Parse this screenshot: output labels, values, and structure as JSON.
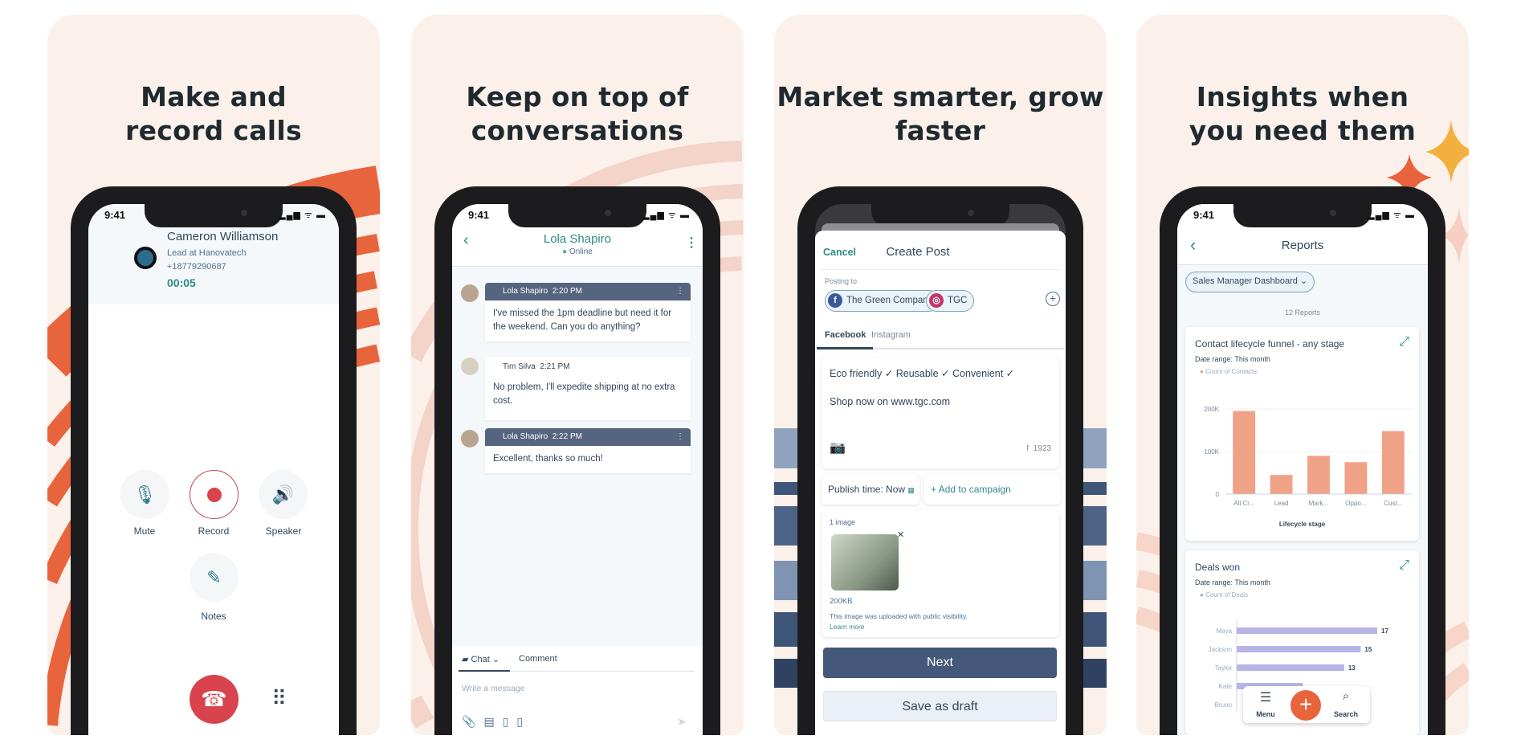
{
  "status_bar": {
    "time": "9:41",
    "icons": "▂▄▆ ᯤ ▬"
  },
  "panels": [
    {
      "headline": [
        "Make and",
        "record calls"
      ],
      "call": {
        "name": "Cameron Williamson",
        "subtitle": "Lead at Hanovatech",
        "phone": "+18779290687",
        "timer": "00:05",
        "actions": [
          {
            "label": "Mute",
            "icon": "microphone-icon"
          },
          {
            "label": "Record",
            "icon": "record-icon"
          },
          {
            "label": "Speaker",
            "icon": "speaker-icon"
          },
          {
            "label": "Notes",
            "icon": "edit-note-icon"
          }
        ],
        "hangup_icon": "phone-hangup-icon",
        "keypad_icon": "keypad-icon"
      }
    },
    {
      "headline": [
        "Keep on top of",
        "conversations"
      ],
      "chat": {
        "contact": "Lola Shapiro",
        "status": "Online",
        "messages": [
          {
            "author": "Lola Shapiro",
            "time": "2:20 PM",
            "text": "I've missed the 1pm deadline but need it for the weekend. Can you do anything?"
          },
          {
            "author": "Tim Silva",
            "time": "2:21 PM",
            "text": "No problem, I'll expedite shipping at no extra cost."
          },
          {
            "author": "Lola Shapiro",
            "time": "2:22 PM",
            "text": "Excellent, thanks so much!"
          }
        ],
        "tabs": [
          "Chat",
          "Comment"
        ],
        "input_placeholder": "Write a message"
      }
    },
    {
      "headline": [
        "Market smarter, grow",
        "faster"
      ],
      "post": {
        "cancel": "Cancel",
        "title": "Create Post",
        "posting_to_label": "Posting to",
        "accounts": [
          "The Green Company",
          "TGC"
        ],
        "tabs": [
          "Facebook",
          "Instagram"
        ],
        "text_lines": [
          "Eco friendly ✓ Reusable ✓ Convenient ✓",
          "Shop now on www.tgc.com"
        ],
        "char_count": "1923",
        "publish_time": "Publish time: Now",
        "add_campaign": "+ Add to campaign",
        "image_count": "1 image",
        "image_size": "200KB",
        "image_note": "This image was uploaded with public visibility.",
        "learn_more": "Learn more",
        "next": "Next",
        "save_draft": "Save as draft"
      }
    },
    {
      "headline": [
        "Insights when",
        "you need them"
      ],
      "reports": {
        "title": "Reports",
        "dashboard": "Sales Manager Dashboard",
        "count": "12 Reports",
        "funnel": {
          "title": "Contact lifecycle funnel - any stage",
          "date_range": "Date range: This month",
          "legend": "Count of Contacts",
          "xlabel": "Lifecycle stage",
          "yticks": [
            "200K",
            "100K",
            "0"
          ],
          "ymax": 200000,
          "categories": [
            "All Cr...",
            "Lead",
            "Mark...",
            "Oppo...",
            "Cust..."
          ],
          "values": [
            195000,
            45000,
            90000,
            75000,
            148000
          ],
          "color": "#f0a287"
        },
        "deals": {
          "title": "Deals won",
          "date_range": "Date range: This month",
          "legend": "Count of Deals",
          "categories": [
            "Maya",
            "Jackson",
            "Taylor",
            "Kate",
            "Bruno"
          ],
          "values": [
            17,
            15,
            13,
            8,
            null
          ],
          "value_labels": [
            "17",
            "15",
            "13",
            "",
            ""
          ],
          "color": "#b7b4e6"
        },
        "nav": [
          "Menu",
          "Search"
        ]
      }
    }
  ],
  "colors": {
    "accent_teal": "#2e8b86",
    "orange": "#e8643c",
    "navy": "#4b5c7a",
    "panel_bg": "#fbf1ea"
  }
}
